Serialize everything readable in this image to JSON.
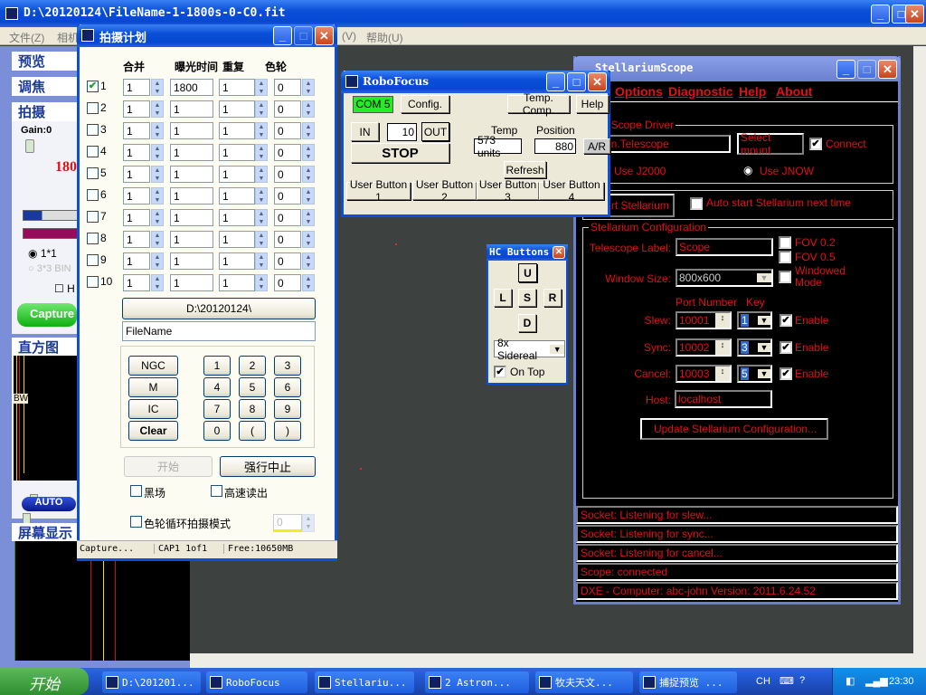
{
  "main_window": {
    "title": "D:\\20120124\\FileName-1-1800s-0-C0.fit",
    "menu": [
      {
        "label": "文件(Z)"
      },
      {
        "label": "相机"
      },
      {
        "label": "(V)"
      },
      {
        "label": "帮助(U)"
      }
    ]
  },
  "left_panel": {
    "tabs": [
      "预览",
      "调焦",
      "拍摄"
    ],
    "gain_label": "Gain:0",
    "exposure_value": "180",
    "bin_1x1": "1*1",
    "bin_3x3": "3*3 BIN",
    "h_checkbox": "H",
    "capture_button": "Capture",
    "capture_sub": "拍摄",
    "histogram_title": "直方图",
    "histogram_markers": "BW",
    "auto_button": "AUTO",
    "display_title": "屏幕显示"
  },
  "plan_window": {
    "title": "拍摄计划",
    "headers": {
      "bin": "合并",
      "exposure": "曝光时间",
      "repeat": "重复",
      "filter": "色轮"
    },
    "rows": [
      {
        "n": "1",
        "checked": true,
        "bin": "1",
        "exposure": "1800",
        "repeat": "1",
        "filter": "0"
      },
      {
        "n": "2",
        "checked": false,
        "bin": "1",
        "exposure": "1",
        "repeat": "1",
        "filter": "0"
      },
      {
        "n": "3",
        "checked": false,
        "bin": "1",
        "exposure": "1",
        "repeat": "1",
        "filter": "0"
      },
      {
        "n": "4",
        "checked": false,
        "bin": "1",
        "exposure": "1",
        "repeat": "1",
        "filter": "0"
      },
      {
        "n": "5",
        "checked": false,
        "bin": "1",
        "exposure": "1",
        "repeat": "1",
        "filter": "0"
      },
      {
        "n": "6",
        "checked": false,
        "bin": "1",
        "exposure": "1",
        "repeat": "1",
        "filter": "0"
      },
      {
        "n": "7",
        "checked": false,
        "bin": "1",
        "exposure": "1",
        "repeat": "1",
        "filter": "0"
      },
      {
        "n": "8",
        "checked": false,
        "bin": "1",
        "exposure": "1",
        "repeat": "1",
        "filter": "0"
      },
      {
        "n": "9",
        "checked": false,
        "bin": "1",
        "exposure": "1",
        "repeat": "1",
        "filter": "0"
      },
      {
        "n": "10",
        "checked": false,
        "bin": "1",
        "exposure": "1",
        "repeat": "1",
        "filter": "0"
      }
    ],
    "path_button": "D:\\20120124\\",
    "filename": "FileName",
    "catalog_buttons": [
      "NGC",
      "M",
      "IC",
      "Clear"
    ],
    "keypad": [
      "1",
      "2",
      "3",
      "4",
      "5",
      "6",
      "7",
      "8",
      "9",
      "0",
      "(",
      ")"
    ],
    "start_button": "开始",
    "abort_button": "强行中止",
    "dark_checkbox": "黑场",
    "fast_readout_checkbox": "高速读出",
    "filter_cycle_checkbox": "色轮循环拍摄模式",
    "filter_cycle_value": "0",
    "status": [
      "Capture...",
      "CAP1 1of1",
      "Free:10650MB"
    ]
  },
  "robofocus": {
    "title": "RoboFocus",
    "com_port": "COM 5",
    "config": "Config.",
    "temp_comp": "Temp. Comp.",
    "help": "Help",
    "in": "IN",
    "step": "10",
    "out": "OUT",
    "stop": "STOP",
    "temp_label": "Temp",
    "temp_value": "573 units",
    "position_label": "Position",
    "position_value": "880",
    "ar": "A/R",
    "refresh": "Refresh",
    "user_buttons": [
      "User Button 1",
      "User Button 2",
      "User Button 3",
      "User Button 4"
    ],
    "com_color": "#22ee22"
  },
  "stellarium": {
    "title": "StellariumScope",
    "menu": [
      "Options",
      "Diagnostic",
      "Help",
      "About"
    ],
    "driver_group": "OM Scope Driver",
    "driver_value": "estron.Telescope",
    "select_mount": "Select mount",
    "connect": "Connect",
    "connect_checked": true,
    "use_j2000": "Use J2000",
    "use_jnow": "Use JNOW",
    "start_stellarium": "art Stellarium",
    "auto_start": "Auto start Stellarium next time",
    "config_group": "Stellarium Configuration",
    "telescope_label": "Telescope Label:",
    "telescope_value": "Scope",
    "fov02": "FOV 0.2",
    "fov05": "FOV 0.5",
    "windowed": "Windowed Mode",
    "window_size_label": "Window Size:",
    "window_size_value": "800x600",
    "port_header": "Port Number",
    "key_header": "Key",
    "ports": [
      {
        "label": "Slew:",
        "port": "10001",
        "key": "1",
        "enable": "Enable"
      },
      {
        "label": "Sync:",
        "port": "10002",
        "key": "3",
        "enable": "Enable"
      },
      {
        "label": "Cancel:",
        "port": "10003",
        "key": "5",
        "enable": "Enable"
      }
    ],
    "host_label": "Host:",
    "host_value": "localhost",
    "update_button": "Update Stellarium Configuration...",
    "status_lines": [
      "Socket: Listening for slew...",
      "Socket: Listening for sync...",
      "Socket: Listening for cancel...",
      "Scope: connected",
      "DXE - Computer: abc-john    Version: 2011.6.24.52"
    ],
    "text_color": "#e0101a"
  },
  "hc_buttons": {
    "title": "HC Buttons",
    "up": "U",
    "left": "L",
    "stop": "S",
    "right": "R",
    "down": "D",
    "rate": "8x Sidereal",
    "on_top": "On Top"
  },
  "taskbar": {
    "start": "开始",
    "items": [
      "D:\\201201...",
      "RoboFocus",
      "Stellariu...",
      "2 Astron...",
      "牧夫天文...",
      "捕捉预览 ..."
    ],
    "lang": "CH",
    "clock": "23:30"
  }
}
